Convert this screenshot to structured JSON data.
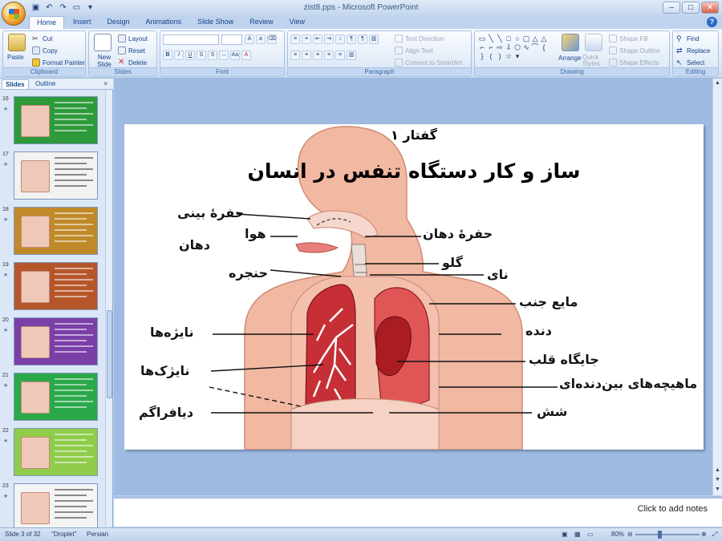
{
  "app": {
    "window_title": "zist8.pps - Microsoft PowerPoint",
    "qat": [
      "save-icon",
      "undo-icon",
      "redo-icon",
      "slideshow-icon",
      "customize-icon"
    ],
    "tabs": [
      "Home",
      "Insert",
      "Design",
      "Animations",
      "Slide Show",
      "Review",
      "View"
    ],
    "active_tab": "Home"
  },
  "ribbon": {
    "clipboard": {
      "label": "Clipboard",
      "paste": "Paste",
      "cut": "Cut",
      "copy": "Copy",
      "format_painter": "Format Painter"
    },
    "slides": {
      "label": "Slides",
      "new_slide": "New Slide",
      "layout": "Layout",
      "reset": "Reset",
      "delete": "Delete"
    },
    "font": {
      "label": "Font"
    },
    "paragraph": {
      "label": "Paragraph",
      "text_direction": "Text Direction",
      "align_text": "Align Text",
      "convert_smartart": "Convert to SmartArt"
    },
    "drawing": {
      "label": "Drawing",
      "arrange": "Arrange",
      "quick_styles": "Quick Styles",
      "shape_fill": "Shape Fill",
      "shape_outline": "Shape Outline",
      "shape_effects": "Shape Effects"
    },
    "editing": {
      "label": "Editing",
      "find": "Find",
      "replace": "Replace",
      "select": "Select"
    }
  },
  "panel": {
    "tab_slides": "Slides",
    "tab_outline": "Outline",
    "close": "×",
    "thumbnails": [
      {
        "num": "16",
        "bg": "#2e9a3a"
      },
      {
        "num": "17",
        "bg": "#f2f2f2"
      },
      {
        "num": "18",
        "bg": "#c08a2a"
      },
      {
        "num": "19",
        "bg": "#b5562a"
      },
      {
        "num": "20",
        "bg": "#7b3fa8"
      },
      {
        "num": "21",
        "bg": "#2aa84a"
      },
      {
        "num": "22",
        "bg": "#8fcc4a"
      },
      {
        "num": "23",
        "bg": "#f4f4f4"
      }
    ]
  },
  "slide": {
    "subtitle": "گفتار ۱",
    "title": "ساز و کار دستگاه تنفس در انسان",
    "labels": {
      "nasal_cavity": "حفرهٔ بینی",
      "air": "هوا",
      "mouth": "دهان",
      "larynx": "حنجره",
      "bronchi": "نایژه‌ها",
      "bronchioles": "نایژک‌ها",
      "diaphragm": "دیافراگم",
      "oral_cavity": "حفرهٔ دهان",
      "throat": "گلو",
      "trachea": "نای",
      "pleural_fluid": "مایع جنب",
      "rib": "دنده",
      "heart_location": "جایگاه قلب",
      "intercostal": "ماهیچه‌های بین‌دنده‌ای",
      "lung": "شش"
    }
  },
  "notes": {
    "placeholder": "Click to add notes"
  },
  "status": {
    "slide": "Slide 3 of 32",
    "theme": "\"Droplet\"",
    "language": "Persian",
    "zoom": "80%"
  }
}
